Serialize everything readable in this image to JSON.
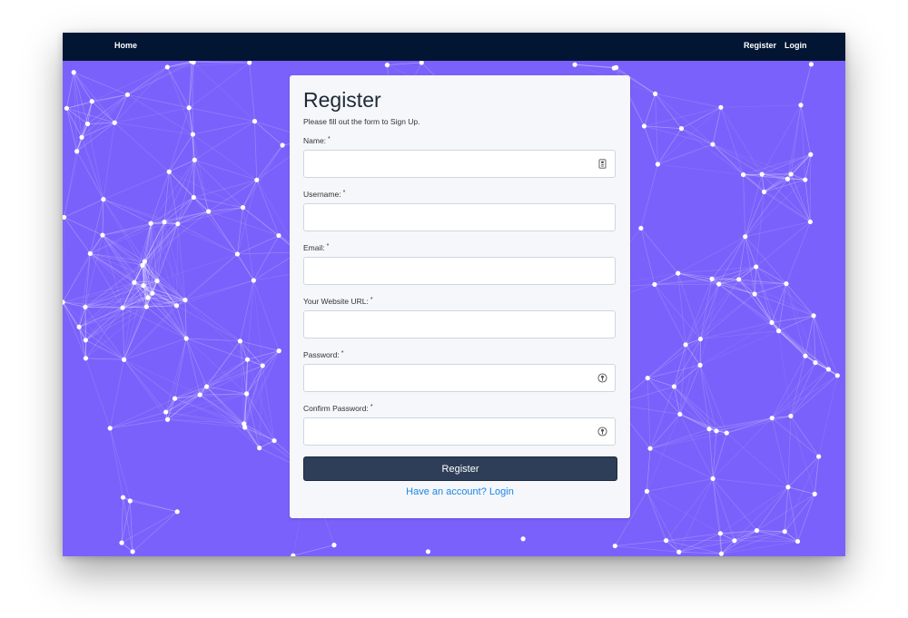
{
  "navbar": {
    "home_label": "Home",
    "register_label": "Register",
    "login_label": "Login"
  },
  "form": {
    "title": "Register",
    "subtitle": "Please fill out the form to Sign Up.",
    "required_mark": "*",
    "fields": [
      {
        "label": "Name:",
        "value": "",
        "icon": "contact-card-icon"
      },
      {
        "label": "Username:",
        "value": ""
      },
      {
        "label": "Email:",
        "value": ""
      },
      {
        "label": "Your Website URL:",
        "value": ""
      },
      {
        "label": "Password:",
        "value": "",
        "icon": "password-key-icon"
      },
      {
        "label": "Confirm Password:",
        "value": "",
        "icon": "password-key-icon"
      }
    ],
    "submit_label": "Register",
    "login_link_label": "Have an account? Login"
  },
  "colors": {
    "navbar_bg": "#021533",
    "page_bg": "#7b61fb",
    "button_bg": "#2e3e58",
    "link": "#1a86e8"
  }
}
